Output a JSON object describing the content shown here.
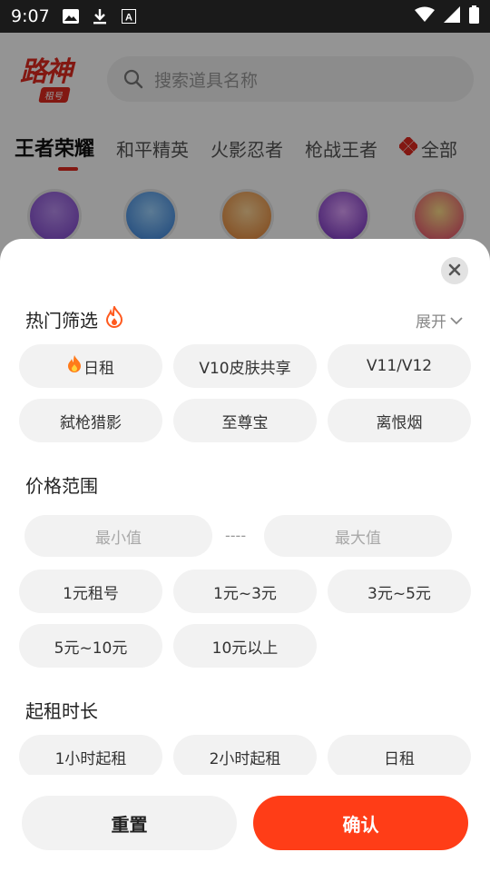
{
  "status_bar": {
    "time": "9:07",
    "icons": [
      "image-icon",
      "download-icon",
      "font-a-icon"
    ],
    "right_icons": [
      "wifi-icon",
      "cellular-icon",
      "battery-icon"
    ]
  },
  "app": {
    "logo_text": "路神",
    "logo_sub": "租号",
    "search_placeholder": "搜索道具名称",
    "tabs": [
      "王者荣耀",
      "和平精英",
      "火影忍者",
      "枪战王者"
    ],
    "all_label": "全部"
  },
  "sheet": {
    "hot": {
      "title": "热门筛选",
      "expand_label": "展开",
      "chips": [
        "日租",
        "V10皮肤共享",
        "V11/V12",
        "弑枪猎影",
        "至尊宝",
        "离恨烟"
      ]
    },
    "price": {
      "title": "价格范围",
      "min_placeholder": "最小值",
      "separator": "----",
      "max_placeholder": "最大值",
      "chips": [
        "1元租号",
        "1元~3元",
        "3元~5元",
        "5元~10元",
        "10元以上"
      ]
    },
    "duration": {
      "title": "起租时长",
      "chips": [
        "1小时起租",
        "2小时起租",
        "日租"
      ]
    },
    "buttons": {
      "reset": "重置",
      "confirm": "确认"
    }
  },
  "colors": {
    "accent": "#ff3d17",
    "brand_red": "#e02a1f",
    "chip_bg": "#f2f2f2"
  }
}
